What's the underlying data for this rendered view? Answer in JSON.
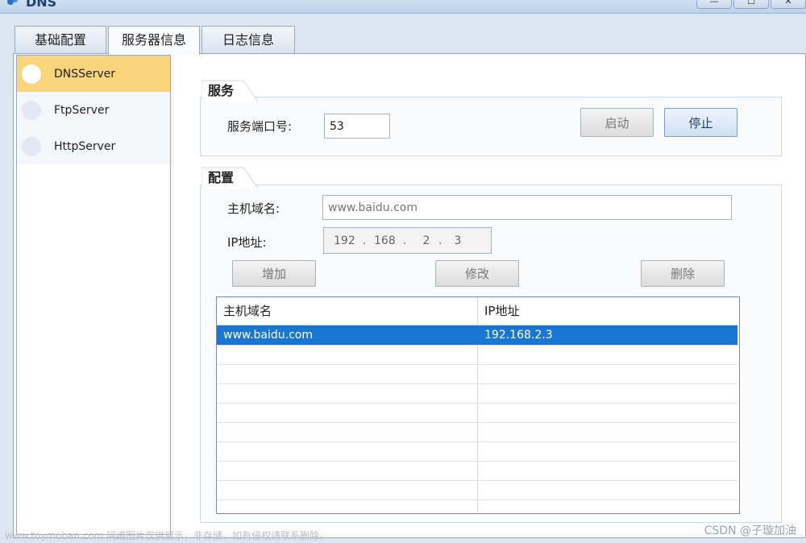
{
  "window": {
    "title": "DNS",
    "minimize": "—",
    "maximize": "☐",
    "close": "✕"
  },
  "tabs": [
    {
      "label": "基础配置"
    },
    {
      "label": "服务器信息"
    },
    {
      "label": "日志信息"
    }
  ],
  "sidebar": {
    "items": [
      {
        "label": "DNSServer"
      },
      {
        "label": "FtpServer"
      },
      {
        "label": "HttpServer"
      }
    ]
  },
  "service": {
    "group_title": "服务",
    "port_label": "服务端口号:",
    "port_value": "53",
    "start_label": "启动",
    "stop_label": "停止"
  },
  "config": {
    "group_title": "配置",
    "host_label": "主机域名:",
    "host_value": "www.baidu.com",
    "ip_label": "IP地址:",
    "ip_octets": [
      "192",
      "168",
      "2",
      "3"
    ],
    "add_label": "增加",
    "modify_label": "修改",
    "delete_label": "删除"
  },
  "table": {
    "columns": [
      "主机域名",
      "IP地址"
    ],
    "rows": [
      {
        "host": "www.baidu.com",
        "ip": "192.168.2.3"
      }
    ]
  },
  "watermark": {
    "left": "www.toymoban.com 网络图片仅供展示，非存储，如有侵权请联系删除。",
    "right": "CSDN @子璇加油"
  }
}
